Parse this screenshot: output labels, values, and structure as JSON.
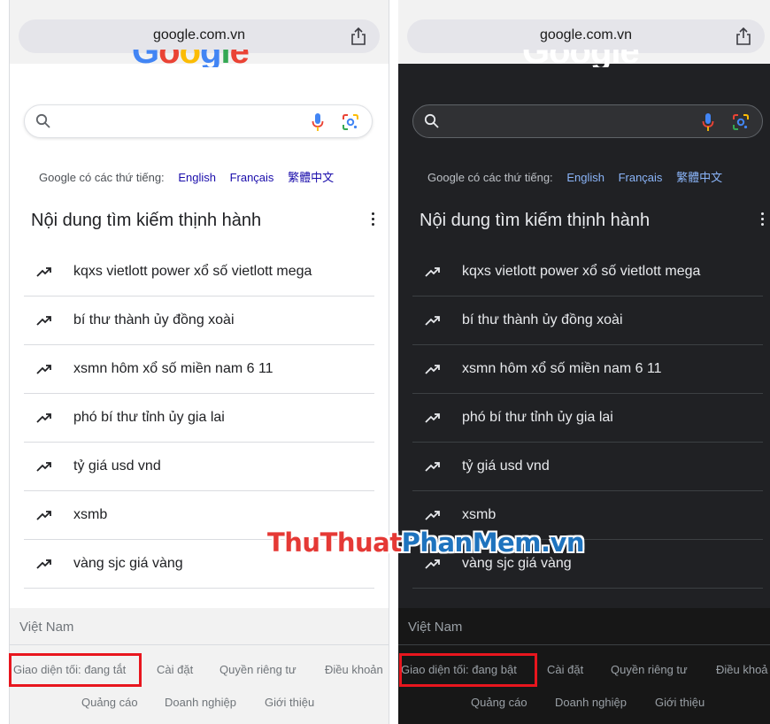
{
  "left_panel": {
    "url": "google.com.vn",
    "lang_prefix": "Google có các thứ tiếng:",
    "languages": [
      "English",
      "Français",
      "繁體中文"
    ],
    "trending_title": "Nội dung tìm kiếm thịnh hành",
    "trends": [
      "kqxs vietlott power xổ số vietlott mega",
      "bí thư thành ủy đồng xoài",
      "xsmn hôm xổ số miền nam 6 11",
      "phó bí thư tỉnh ủy gia lai",
      "tỷ giá usd vnd",
      "xsmb",
      "vàng sjc giá vàng"
    ],
    "country": "Việt Nam",
    "footer_row1": [
      "Giao diện tối: đang tắt",
      "Cài đặt",
      "Quyền riêng tư",
      "Điều khoản"
    ],
    "footer_row2": [
      "Quảng cáo",
      "Doanh nghiệp",
      "Giới thiệu"
    ]
  },
  "right_panel": {
    "url": "google.com.vn",
    "lang_prefix": "Google có các thứ tiếng:",
    "languages": [
      "English",
      "Français",
      "繁體中文"
    ],
    "trending_title": "Nội dung tìm kiếm thịnh hành",
    "trends": [
      "kqxs vietlott power xổ số vietlott mega",
      "bí thư thành ủy đồng xoài",
      "xsmn hôm xổ số miền nam 6 11",
      "phó bí thư tỉnh ủy gia lai",
      "tỷ giá usd vnd",
      "xsmb",
      "vàng sjc giá vàng"
    ],
    "country": "Việt Nam",
    "footer_row1": [
      "Giao diện tối: đang bật",
      "Cài đặt",
      "Quyền riêng tư",
      "Điều khoả"
    ],
    "footer_row2": [
      "Quảng cáo",
      "Doanh nghiệp",
      "Giới thiệu"
    ]
  },
  "watermark": {
    "part1": "ThuThuat",
    "part2": "PhanMem",
    "part3": ".vn"
  },
  "colors": {
    "highlight": "#e8161e",
    "dark_bg": "#202124",
    "link_light": "#1a0dab",
    "link_dark": "#8ab4f8"
  }
}
